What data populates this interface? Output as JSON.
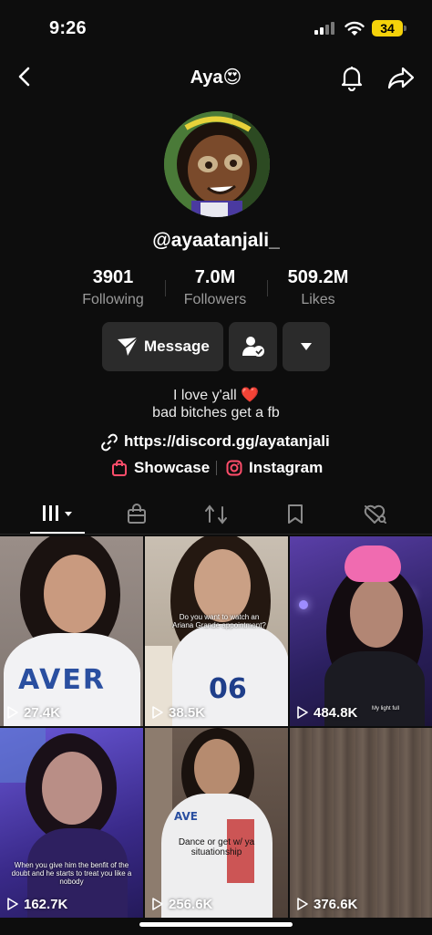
{
  "status": {
    "time": "9:26",
    "battery": "34"
  },
  "nav": {
    "title": "Aya😍"
  },
  "profile": {
    "username": "@ayaatanjali_",
    "stats": [
      {
        "value": "3901",
        "label": "Following"
      },
      {
        "value": "7.0M",
        "label": "Followers"
      },
      {
        "value": "509.2M",
        "label": "Likes"
      }
    ],
    "message_label": "Message",
    "bio_line1": "I love y'all",
    "bio_heart": "❤️",
    "bio_line2": "bad bitches get a fb",
    "link": "https://discord.gg/ayatanjali",
    "showcase_label": "Showcase",
    "instagram_label": "Instagram"
  },
  "videos": [
    {
      "views": "27.4K"
    },
    {
      "views": "38.5K",
      "caption": "Do you want to watch an Ariana Grande appointment?"
    },
    {
      "views": "484.8K",
      "caption": "My light full"
    },
    {
      "views": "162.7K",
      "caption": "When you give him the benfit of the doubt and he starts to treat you like a nobody"
    },
    {
      "views": "256.6K",
      "caption": "Dance or get w/ ya situationship"
    },
    {
      "views": "376.6K"
    }
  ],
  "colors": {
    "background": "#0d0d0d",
    "button": "#2b2b2b",
    "battery": "#f5d20a",
    "heart": "#e0242e",
    "showcase": "#ff4d6a"
  }
}
